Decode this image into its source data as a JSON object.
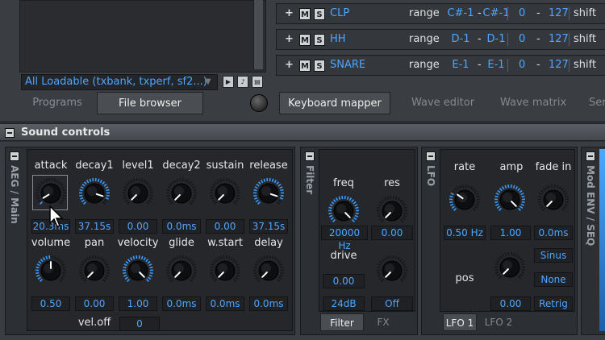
{
  "browser": {
    "loadable": "All Loadable (txbank, txperf, sf2...)",
    "tabs": [
      "Programs",
      "File browser"
    ]
  },
  "mapper": {
    "rows": [
      {
        "m": "M",
        "s": "S",
        "name": "CLP",
        "range_label": "range",
        "lo": "C#-1",
        "hi": "C#-1",
        "vlo": "0",
        "vhi": "127",
        "shift": "shift"
      },
      {
        "m": "M",
        "s": "S",
        "name": "HH",
        "range_label": "range",
        "lo": "D-1",
        "hi": "D-1",
        "vlo": "0",
        "vhi": "127",
        "shift": "shift"
      },
      {
        "m": "M",
        "s": "S",
        "name": "SNARE",
        "range_label": "range",
        "lo": "E-1",
        "hi": "E-1",
        "vlo": "0",
        "vhi": "127",
        "shift": "shift"
      }
    ],
    "dash": "-",
    "tabs": [
      "Keyboard mapper",
      "Wave editor",
      "Wave matrix",
      "Ser"
    ]
  },
  "sound_controls": {
    "title": "Sound controls",
    "aeg": {
      "vtitle": "AEG / Main",
      "row1": [
        {
          "label": "attack",
          "value": "20.3ms",
          "level": 0.05
        },
        {
          "label": "decay1",
          "value": "37.15s",
          "level": 0.9
        },
        {
          "label": "level1",
          "value": "0.00",
          "level": 0.0
        },
        {
          "label": "decay2",
          "value": "0.0ms",
          "level": 0.0
        },
        {
          "label": "sustain",
          "value": "0.00",
          "level": 0.0
        },
        {
          "label": "release",
          "value": "37.15s",
          "level": 0.9
        }
      ],
      "row2": [
        {
          "label": "volume",
          "value": "0.50",
          "level": 0.5
        },
        {
          "label": "pan",
          "value": "0.00",
          "level": 0.0
        },
        {
          "label": "velocity",
          "value": "1.00",
          "level": 1.0
        },
        {
          "label": "glide",
          "value": "0.0ms",
          "level": 0.0
        },
        {
          "label": "w.start",
          "value": "0.0ms",
          "level": 0.0
        },
        {
          "label": "delay",
          "value": "0.0ms",
          "level": 0.0
        }
      ],
      "veloff_label": "vel.off",
      "veloff_value": "0"
    },
    "filter": {
      "vtitle": "Filter",
      "freq": {
        "label": "freq",
        "value": "20000 Hz",
        "level": 1.0
      },
      "res": {
        "label": "res",
        "value": "0.00",
        "level": 0.0
      },
      "drive": {
        "label": "drive",
        "value": "0.00",
        "level": 0.0
      },
      "slope": "24dB",
      "mode": "Off",
      "tabs": [
        "Filter",
        "FX"
      ]
    },
    "lfo": {
      "vtitle": "LFO",
      "rate": {
        "label": "rate",
        "value": "0.50 Hz",
        "level": 0.3
      },
      "amp": {
        "label": "amp",
        "value": "1.00",
        "level": 1.0
      },
      "fadein": {
        "label": "fade in",
        "value": "0.0ms",
        "level": 0.0
      },
      "pos": {
        "label": "pos",
        "value": "0.00",
        "level": 0.0
      },
      "wave": "Sinus",
      "sync": "None",
      "retrig": "Retrig",
      "tabs": [
        "LFO 1",
        "LFO 2"
      ]
    },
    "mod": {
      "vtitle": "Mod ENV / SEQ"
    }
  },
  "colors": {
    "accent": "#4fa6ff",
    "ring": "#3a9cff"
  }
}
